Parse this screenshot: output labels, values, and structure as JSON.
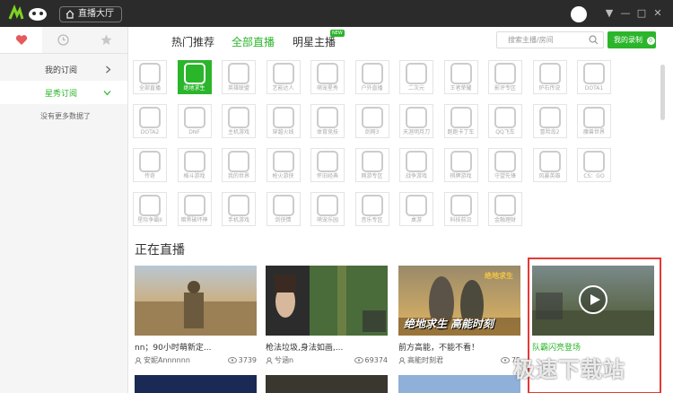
{
  "titlebar": {
    "tab_label": "直播大厅",
    "window_controls": [
      "▼",
      "—",
      "□",
      "✕"
    ]
  },
  "sidebar": {
    "tabs": [
      {
        "icon": "heart-icon",
        "active": true
      },
      {
        "icon": "clock-icon",
        "active": false
      },
      {
        "icon": "star-icon",
        "active": false
      }
    ],
    "items": [
      {
        "label": "我的订阅",
        "chevron": "right",
        "active": false
      },
      {
        "label": "星秀订阅",
        "chevron": "down",
        "active": true
      }
    ],
    "empty_note": "没有更多数据了"
  },
  "nav": {
    "tabs": [
      "热门推荐",
      "全部直播",
      "明星主播"
    ],
    "active_tab": 1,
    "new_badge": "NEW",
    "search_placeholder": "搜索主播/房间",
    "record_label": "我的录制",
    "record_count": "0"
  },
  "categories": [
    {
      "label": "全部直播",
      "active": false
    },
    {
      "label": "绝地求生",
      "active": true
    },
    {
      "label": "英雄联盟",
      "active": false
    },
    {
      "label": "艺能达人",
      "active": false
    },
    {
      "label": "萌宠星秀",
      "active": false
    },
    {
      "label": "户外直播",
      "active": false
    },
    {
      "label": "二次元",
      "active": false
    },
    {
      "label": "王者荣耀",
      "active": false
    },
    {
      "label": "影评专区",
      "active": false
    },
    {
      "label": "炉石传说",
      "active": false
    },
    {
      "label": "DOTA1",
      "active": false
    },
    {
      "label": "DOTA2",
      "active": false
    },
    {
      "label": "DNF",
      "active": false
    },
    {
      "label": "主机游戏",
      "active": false
    },
    {
      "label": "穿越火线",
      "active": false
    },
    {
      "label": "体育竞技",
      "active": false
    },
    {
      "label": "剑网3",
      "active": false
    },
    {
      "label": "天涯明月刀",
      "active": false
    },
    {
      "label": "跑跑卡丁车",
      "active": false
    },
    {
      "label": "QQ飞车",
      "active": false
    },
    {
      "label": "冒险岛2",
      "active": false
    },
    {
      "label": "魔兽世界",
      "active": false
    },
    {
      "label": "传奇",
      "active": false
    },
    {
      "label": "格斗游戏",
      "active": false
    },
    {
      "label": "我的世界",
      "active": false
    },
    {
      "label": "枪火游侠",
      "active": false
    },
    {
      "label": "怀旧经典",
      "active": false
    },
    {
      "label": "网游专区",
      "active": false
    },
    {
      "label": "战争游戏",
      "active": false
    },
    {
      "label": "棋牌游戏",
      "active": false
    },
    {
      "label": "守望先锋",
      "active": false
    },
    {
      "label": "风暴英雄",
      "active": false
    },
    {
      "label": "CS：GO",
      "active": false
    },
    {
      "label": "星际争霸II",
      "active": false
    },
    {
      "label": "暗黑破坏神",
      "active": false
    },
    {
      "label": "手机游戏",
      "active": false
    },
    {
      "label": "剑侠情",
      "active": false
    },
    {
      "label": "萌宠乐园",
      "active": false
    },
    {
      "label": "音乐专区",
      "active": false
    },
    {
      "label": "桌游",
      "active": false
    },
    {
      "label": "科技前沿",
      "active": false
    },
    {
      "label": "金融理财",
      "active": false
    }
  ],
  "live": {
    "section_title": "正在直播",
    "cards": [
      {
        "title": "nn；90小时萌新定...",
        "author": "安妮Annnnnn",
        "viewers": "3739",
        "highlight": false
      },
      {
        "title": "枪法垃圾,身法如画,...",
        "author": "兮涵n",
        "viewers": "69374",
        "highlight": false
      },
      {
        "title": "前方高能，不能不看！",
        "author": "高能时刻君",
        "viewers": "75",
        "highlight": false
      },
      {
        "title": "队霸闪亮登场",
        "author": "",
        "viewers": "",
        "highlight": true
      }
    ],
    "thumb_text": {
      "card3_logo": "绝地求生",
      "card3_banner": "绝地求生 高能时刻"
    }
  },
  "watermark": "极速下载站",
  "colors": {
    "accent": "#2bb52b",
    "titlebar": "#2b2b2b",
    "highlight_box": "#e53935"
  }
}
